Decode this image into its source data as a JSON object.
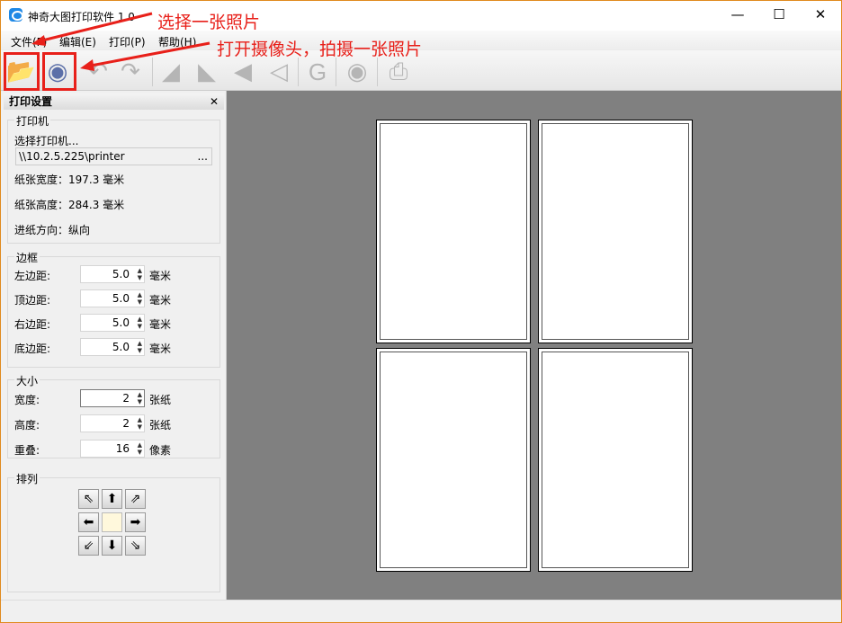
{
  "window": {
    "title": "神奇大图打印软件 1.0"
  },
  "menu": [
    "文件(F)",
    "编辑(E)",
    "打印(P)",
    "帮助(H)"
  ],
  "annotations": {
    "open_photo": "选择一张照片",
    "camera": "打开摄像头，拍摄一张照片",
    "color": "#e8201a"
  },
  "panel": {
    "title": "打印设置",
    "printer": {
      "group": "打印机",
      "select_label": "选择打印机...",
      "printer_path": "\\\\10.2.5.225\\printer",
      "browse": "...",
      "paper_width": "纸张宽度：197.3 毫米",
      "paper_height": "纸张高度：284.3 毫米",
      "orientation": "进纸方向：纵向"
    },
    "margins": {
      "group": "边框",
      "rows": [
        {
          "label": "左边距:",
          "value": "5.0",
          "unit": "毫米"
        },
        {
          "label": "顶边距:",
          "value": "5.0",
          "unit": "毫米"
        },
        {
          "label": "右边距:",
          "value": "5.0",
          "unit": "毫米"
        },
        {
          "label": "底边距:",
          "value": "5.0",
          "unit": "毫米"
        }
      ]
    },
    "size": {
      "group": "大小",
      "rows": [
        {
          "label": "宽度:",
          "value": "2",
          "unit": "张纸"
        },
        {
          "label": "高度:",
          "value": "2",
          "unit": "张纸"
        },
        {
          "label": "重叠:",
          "value": "16",
          "unit": "像素"
        }
      ]
    },
    "arrange": {
      "group": "排列"
    }
  }
}
